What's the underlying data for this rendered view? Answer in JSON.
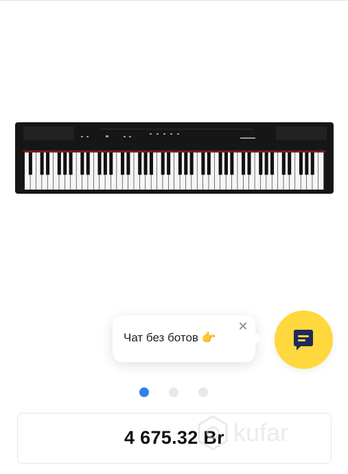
{
  "product": {
    "image_alt": "Yamaha P-125 digital piano"
  },
  "chat": {
    "text": "Чат без ботов 👉",
    "close_glyph": "✕",
    "accent": "#ffd83d"
  },
  "carousel": {
    "count": 3,
    "active_index": 0,
    "active_color": "#2f80ed"
  },
  "price": {
    "value": "4 675.32 Br"
  },
  "watermark": {
    "text": "kufar"
  }
}
